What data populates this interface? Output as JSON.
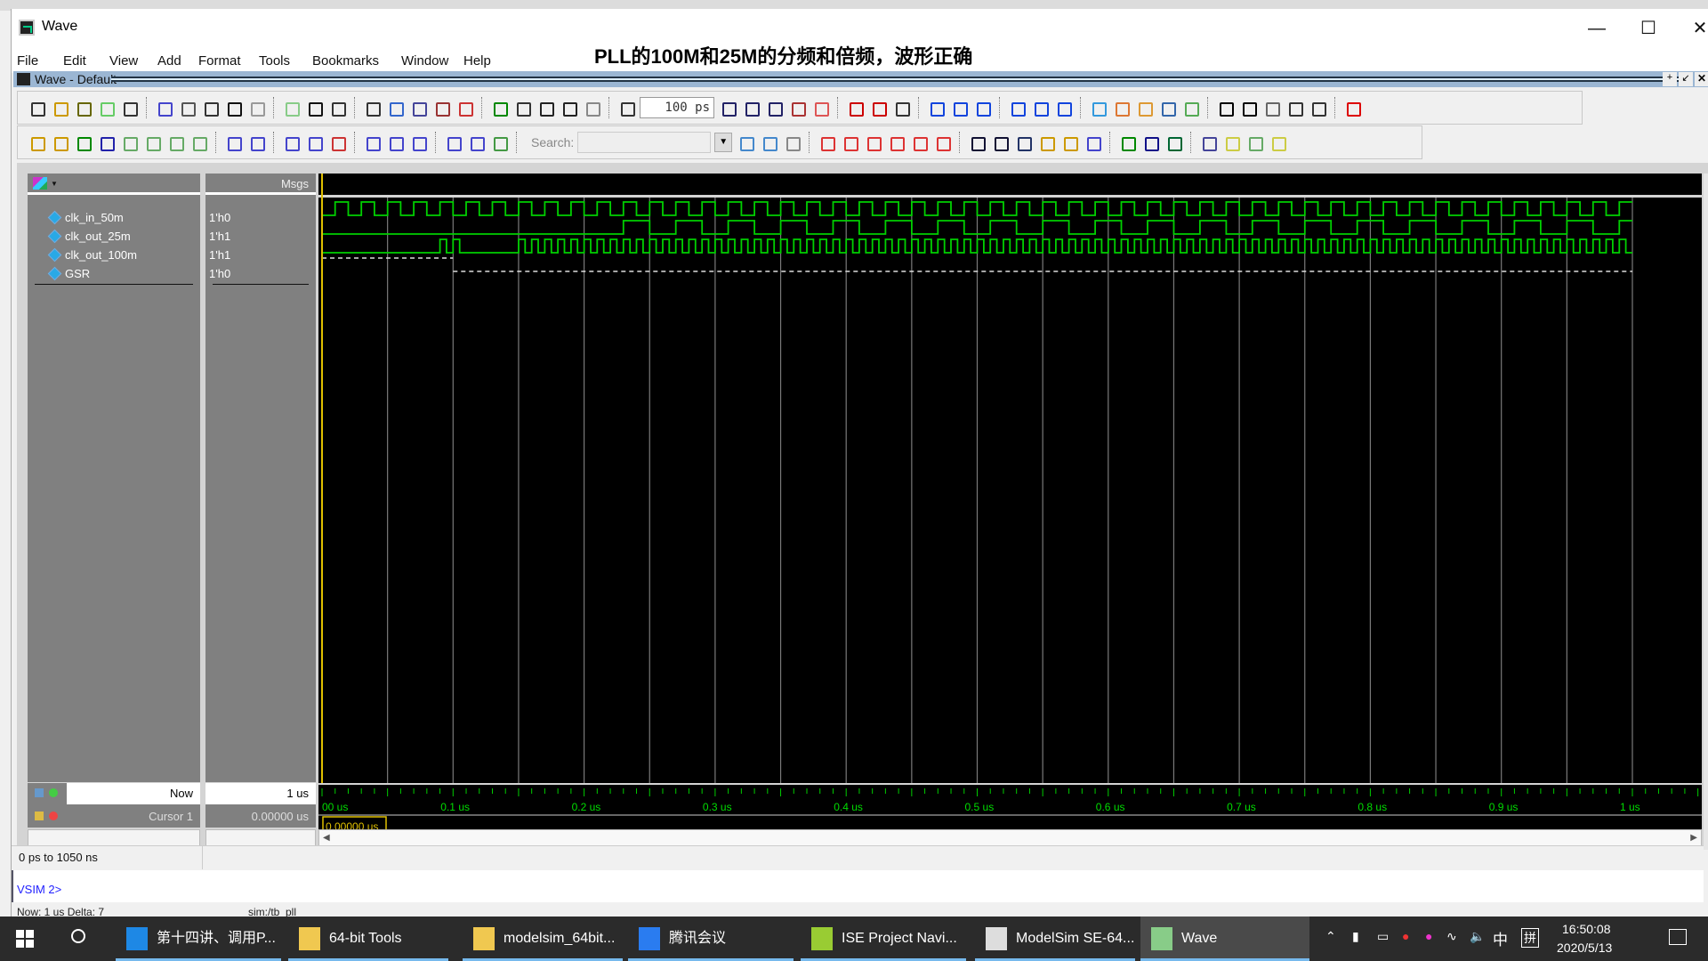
{
  "window": {
    "title": "Wave",
    "overlay_caption": "PLL的100M和25M的分频和倍频，波形正确"
  },
  "menu": [
    "File",
    "Edit",
    "View",
    "Add",
    "Format",
    "Tools",
    "Bookmarks",
    "Window",
    "Help"
  ],
  "subwindow": {
    "title": "Wave - Default"
  },
  "toolbar": {
    "time_step": "100 ps",
    "search_label": "Search:",
    "search_value": "",
    "row1_icons": [
      {
        "name": "new-file",
        "color": "#333"
      },
      {
        "name": "open-folder",
        "color": "#c90"
      },
      {
        "name": "save",
        "color": "#660"
      },
      {
        "name": "reload",
        "color": "#6c6"
      },
      {
        "name": "print",
        "color": "#333"
      },
      {
        "sep": true
      },
      {
        "name": "cut",
        "color": "#44c"
      },
      {
        "name": "copy",
        "color": "#555"
      },
      {
        "name": "paste",
        "color": "#333"
      },
      {
        "name": "undo",
        "color": "#111"
      },
      {
        "name": "redo",
        "color": "#999"
      },
      {
        "sep": true
      },
      {
        "name": "help-circle",
        "color": "#8c8"
      },
      {
        "name": "find",
        "color": "#111"
      },
      {
        "name": "expand-compare",
        "color": "#333"
      },
      {
        "sep": true
      },
      {
        "name": "load-dataset",
        "color": "#333"
      },
      {
        "name": "dataset-help",
        "color": "#36c"
      },
      {
        "name": "dataset-grid",
        "color": "#449"
      },
      {
        "name": "dataset-run",
        "color": "#933"
      },
      {
        "name": "dataset-close",
        "color": "#c33"
      },
      {
        "sep": true
      },
      {
        "name": "link-compile",
        "color": "#080"
      },
      {
        "name": "sim-list",
        "color": "#333"
      },
      {
        "name": "up-arrow",
        "color": "#222"
      },
      {
        "name": "left-arrow",
        "color": "#222"
      },
      {
        "name": "right-arrow",
        "color": "#888"
      },
      {
        "sep": true
      },
      {
        "name": "restart",
        "color": "#333"
      },
      {
        "field": "time_step"
      },
      {
        "name": "run",
        "color": "#226"
      },
      {
        "name": "continue",
        "color": "#226"
      },
      {
        "name": "run-all",
        "color": "#226"
      },
      {
        "name": "break",
        "color": "#a33"
      },
      {
        "name": "stop",
        "color": "#d55"
      },
      {
        "sep": true
      },
      {
        "name": "performance-analyzer",
        "color": "#c00"
      },
      {
        "name": "memory-profiler",
        "color": "#c00"
      },
      {
        "name": "hand",
        "color": "#333"
      },
      {
        "sep": true
      },
      {
        "name": "step-into",
        "color": "#14d"
      },
      {
        "name": "step-over",
        "color": "#14d"
      },
      {
        "name": "step-out",
        "color": "#14d"
      },
      {
        "sep": true
      },
      {
        "name": "step-back",
        "color": "#14d"
      },
      {
        "name": "step-over-back",
        "color": "#14d"
      },
      {
        "name": "step-out-back",
        "color": "#14d"
      },
      {
        "sep": true
      },
      {
        "name": "add-bookmark",
        "color": "#39d"
      },
      {
        "name": "remove-bookmark",
        "color": "#d73"
      },
      {
        "name": "edit-bookmark",
        "color": "#d93"
      },
      {
        "name": "save-bookmark",
        "color": "#36a"
      },
      {
        "name": "goto-bookmark",
        "color": "#5a5"
      },
      {
        "sep": true
      },
      {
        "name": "select-pointer",
        "color": "#000"
      },
      {
        "name": "zoom-mode",
        "color": "#000"
      },
      {
        "name": "pan-mode",
        "color": "#666"
      },
      {
        "name": "measure-mode",
        "color": "#333"
      },
      {
        "name": "edit-mode",
        "color": "#333"
      },
      {
        "sep": true
      },
      {
        "name": "traffic-light",
        "color": "#d00"
      }
    ],
    "row2_icons": [
      {
        "name": "insert-cursor",
        "color": "#c90"
      },
      {
        "name": "delete-cursor",
        "color": "#c90"
      },
      {
        "name": "previous-transition",
        "color": "#080"
      },
      {
        "name": "next-transition",
        "color": "#22a"
      },
      {
        "name": "previous-falling-edge",
        "color": "#6a6"
      },
      {
        "name": "next-falling-edge",
        "color": "#6a6"
      },
      {
        "name": "previous-rising-edge",
        "color": "#6a6"
      },
      {
        "name": "next-rising-edge",
        "color": "#6a6"
      },
      {
        "sep": true
      },
      {
        "name": "expand-time",
        "color": "#44c"
      },
      {
        "name": "collapse-time",
        "color": "#44c"
      },
      {
        "sep": true
      },
      {
        "name": "expand-delta",
        "color": "#44c"
      },
      {
        "name": "expand-delta-all",
        "color": "#44c"
      },
      {
        "name": "collapse-delta",
        "color": "#c33"
      },
      {
        "sep": true
      },
      {
        "name": "wave-edit-1",
        "color": "#44c"
      },
      {
        "name": "wave-edit-2",
        "color": "#44c"
      },
      {
        "name": "wave-edit-3",
        "color": "#44c"
      },
      {
        "sep": true
      },
      {
        "name": "trace-driver",
        "color": "#44c"
      },
      {
        "name": "trace-readers",
        "color": "#44c"
      },
      {
        "name": "trace-x",
        "color": "#494"
      },
      {
        "sep": true
      },
      {
        "field": "search"
      },
      {
        "name": "search-forward",
        "color": "#48c"
      },
      {
        "name": "search-backward",
        "color": "#48c"
      },
      {
        "name": "search-options",
        "color": "#888"
      },
      {
        "sep": true
      },
      {
        "name": "first-bookmark",
        "color": "#d33"
      },
      {
        "name": "previous-bookmark",
        "color": "#d33"
      },
      {
        "name": "jump-left",
        "color": "#d33"
      },
      {
        "name": "jump-right",
        "color": "#d33"
      },
      {
        "name": "next-bookmark",
        "color": "#d33"
      },
      {
        "name": "last-bookmark",
        "color": "#d33"
      },
      {
        "sep": true
      },
      {
        "name": "zoom-in",
        "color": "#113"
      },
      {
        "name": "zoom-out",
        "color": "#113"
      },
      {
        "name": "zoom-full",
        "color": "#236"
      },
      {
        "name": "zoom-cursor",
        "color": "#c90"
      },
      {
        "name": "zoom-cursors",
        "color": "#c90"
      },
      {
        "name": "zoom-region",
        "color": "#44c"
      },
      {
        "sep": true
      },
      {
        "name": "wave-single",
        "color": "#080"
      },
      {
        "name": "wave-pulse",
        "color": "#118"
      },
      {
        "name": "wave-filled",
        "color": "#063"
      },
      {
        "sep": true
      },
      {
        "name": "wave-pattern",
        "color": "#449"
      },
      {
        "name": "wave-edge-1",
        "color": "#cc4"
      },
      {
        "name": "wave-edge-2",
        "color": "#6a6"
      },
      {
        "name": "wave-edge-3",
        "color": "#cc4"
      }
    ]
  },
  "wave": {
    "header": {
      "msgs_label": "Msgs"
    },
    "signals": [
      {
        "name": "clk_in_50m",
        "value": "1'h0"
      },
      {
        "name": "clk_out_25m",
        "value": "1'h1"
      },
      {
        "name": "clk_out_100m",
        "value": "1'h1"
      },
      {
        "name": "GSR",
        "value": "1'h0"
      }
    ],
    "now": {
      "label": "Now",
      "value": "1 us"
    },
    "cursor": {
      "label": "Cursor 1",
      "value": "0.00000 us",
      "marker": "0.00000 us",
      "time_ns": 0
    },
    "axis_labels": [
      "00 us",
      "0.1 us",
      "0.2 us",
      "0.3 us",
      "0.4 us",
      "0.5 us",
      "0.6 us",
      "0.7 us",
      "0.8 us",
      "0.9 us",
      "1 us"
    ],
    "range_ns": [
      0,
      1050
    ],
    "sim_end_ns": 1000,
    "waveforms": [
      {
        "initial": 0,
        "segments": [
          {
            "from": 10,
            "to": 1000,
            "half_period": 10
          }
        ],
        "edges": []
      },
      {
        "initial": 0,
        "segments": [
          {
            "from": 230,
            "to": 1000,
            "half_period": 20
          }
        ],
        "edges": []
      },
      {
        "initial": 0,
        "segments": [
          {
            "from": 150,
            "to": 1000,
            "half_period": 5
          }
        ],
        "edges": [
          90,
          95,
          100,
          105
        ]
      },
      {
        "initial": 1,
        "segments": [],
        "edges": [
          100
        ],
        "style": "dashed"
      }
    ],
    "wave_color": "#00d000",
    "cursor_color": "#e0c000"
  },
  "status": {
    "range": "0 ps to 1050 ns",
    "prompt": "VSIM 2>",
    "now_delta": "Now: 1 us  Delta: 7",
    "sim_path": "sim:/tb_pll"
  },
  "taskbar": {
    "items": [
      {
        "label": "第十四讲、调用P...",
        "icon": "edge-browser"
      },
      {
        "label": "64-bit Tools",
        "icon": "folder"
      },
      {
        "label": "modelsim_64bit...",
        "icon": "folder"
      },
      {
        "label": "腾讯会议",
        "icon": "tencent-meeting"
      },
      {
        "label": "ISE Project Navi...",
        "icon": "ise"
      },
      {
        "label": "ModelSim SE-64...",
        "icon": "modelsim"
      },
      {
        "label": "Wave",
        "icon": "wave"
      }
    ],
    "ime": "中",
    "ime2": "拼",
    "time": "16:50:08",
    "date": "2020/5/13"
  }
}
